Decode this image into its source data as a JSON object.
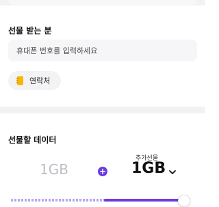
{
  "recipient": {
    "title": "선물 받는 분",
    "phone_placeholder": "휴대폰 번호를 입력하세요",
    "phone_value": "",
    "contacts_button_label": "연락처",
    "contacts_icon": "contacts-book-icon"
  },
  "data_gift": {
    "title": "선물할 데이터",
    "base_value": "1GB",
    "plus_symbol": "+",
    "extra_label": "추가선물",
    "extra_value": "1GB",
    "slider_level": 0.96
  },
  "colors": {
    "accent": "#6b3ce0",
    "track_dash": "#b9a6ef",
    "input_bg": "#f6f6f8",
    "muted_text": "#bdbdc3",
    "icon_yellow": "#f5b800"
  }
}
